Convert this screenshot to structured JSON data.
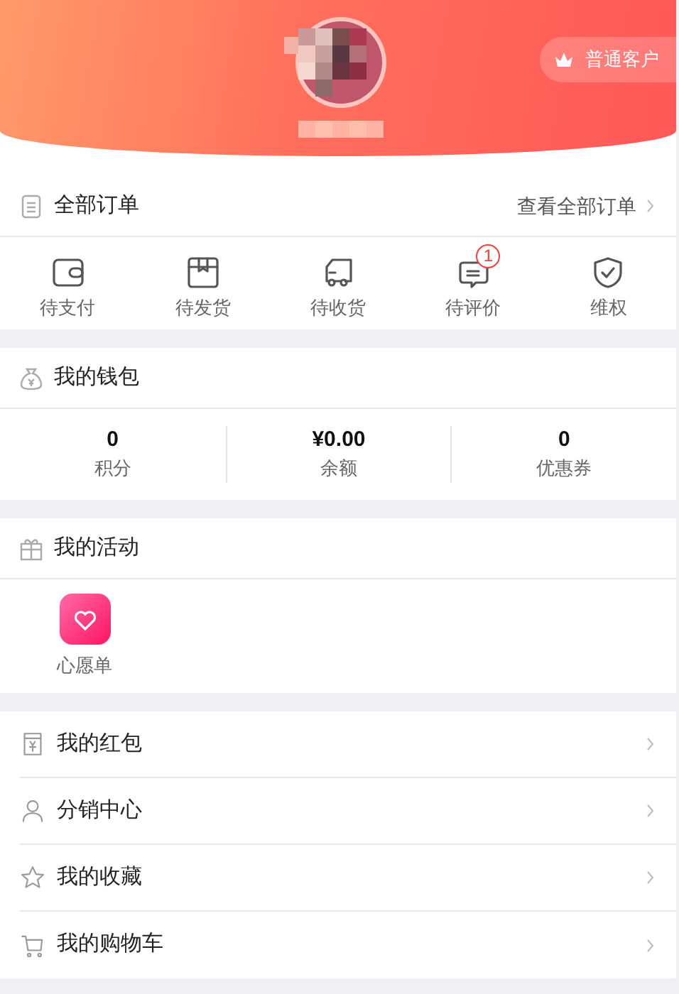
{
  "profile": {
    "badge": "普通客户"
  },
  "orders": {
    "title": "全部订单",
    "link": "查看全部订单",
    "statuses": [
      {
        "label": "待支付"
      },
      {
        "label": "待发货"
      },
      {
        "label": "待收货"
      },
      {
        "label": "待评价",
        "badge": "1"
      },
      {
        "label": "维权"
      }
    ]
  },
  "wallet": {
    "title": "我的钱包",
    "stats": [
      {
        "value": "0",
        "label": "积分"
      },
      {
        "value": "¥0.00",
        "label": "余额"
      },
      {
        "value": "0",
        "label": "优惠券"
      }
    ]
  },
  "activities": {
    "title": "我的活动",
    "items": [
      {
        "label": "心愿单"
      }
    ]
  },
  "menu": [
    {
      "label": "我的红包"
    },
    {
      "label": "分销中心"
    },
    {
      "label": "我的收藏"
    },
    {
      "label": "我的购物车"
    }
  ]
}
